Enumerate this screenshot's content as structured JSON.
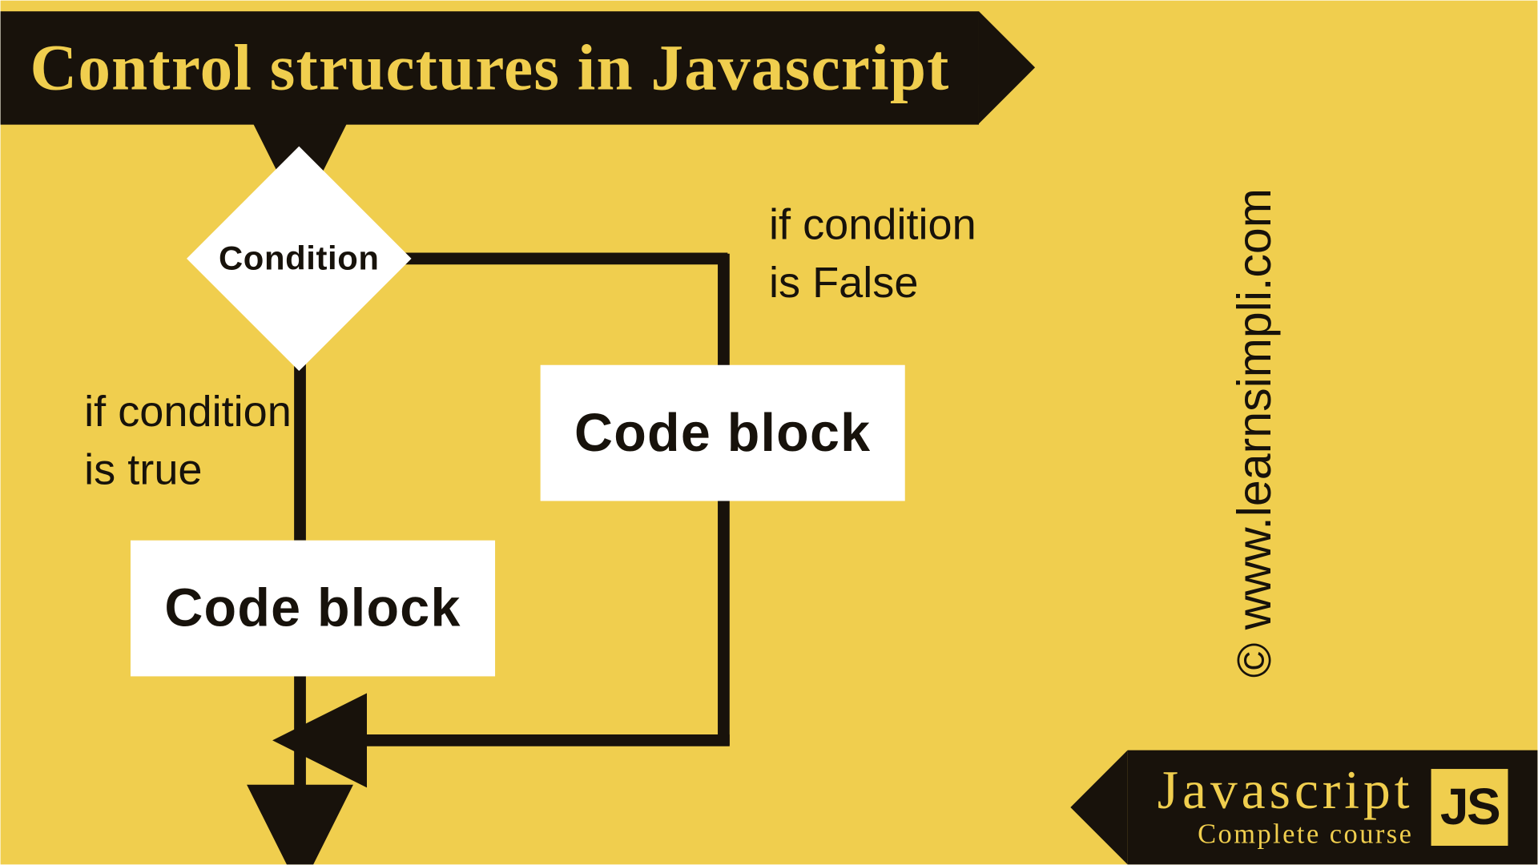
{
  "title": "Control structures in Javascript",
  "flow": {
    "decision": "Condition",
    "true_label_line1": "if condition",
    "true_label_line2": "is true",
    "false_label_line1": "if condition",
    "false_label_line2": "is False",
    "true_block": "Code block",
    "false_block": "Code block"
  },
  "copyright": "© www.learnsimpli.com",
  "footer": {
    "title": "Javascript",
    "subtitle": "Complete course",
    "badge": "JS"
  },
  "colors": {
    "bg": "#f0ce4e",
    "ink": "#18120b",
    "box": "#ffffff"
  }
}
